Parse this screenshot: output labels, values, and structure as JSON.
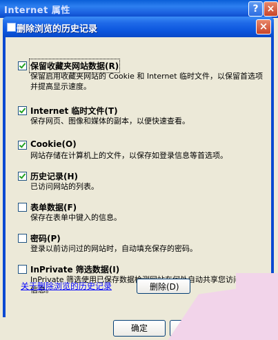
{
  "outer": {
    "title": "Internet 属性",
    "help": "?",
    "close": "×",
    "ok_label": "确定"
  },
  "dialog": {
    "title": "删除浏览的历史记录",
    "close": "×",
    "options": [
      {
        "label": "保留收藏夹网站数据(R)",
        "checked": true,
        "desc": "保留启用收藏夹网站的 Cookie 和 Internet 临时文件，以保留首选项并提高显示速度。"
      },
      {
        "label": "Internet 临时文件(T)",
        "checked": true,
        "desc": "保存网页、图像和媒体的副本，以便快速查看。"
      },
      {
        "label": "Cookie(O)",
        "checked": true,
        "desc": "网站存储在计算机上的文件，以保存如登录信息等首选项。"
      },
      {
        "label": "历史记录(H)",
        "checked": true,
        "desc": "已访问网站的列表。"
      },
      {
        "label": "表单数据(F)",
        "checked": false,
        "desc": "保存在表单中键入的信息。"
      },
      {
        "label": "密码(P)",
        "checked": false,
        "desc": "登录以前访问过的网站时，自动填充保存的密码。"
      },
      {
        "label": "InPrivate 筛选数据(I)",
        "checked": false,
        "desc": "InPrivate 筛选使用已保存数据检测网站在何处自动共享您访问的详细信息。"
      }
    ],
    "link": "关于删除浏览的历史记录",
    "delete_label": "删除(D)"
  }
}
